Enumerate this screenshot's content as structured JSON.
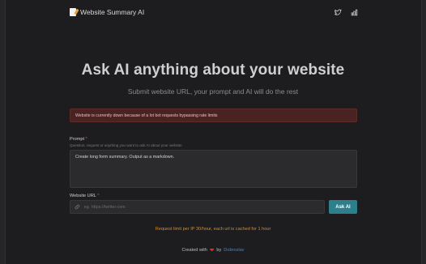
{
  "header": {
    "title": "Website Summary AI",
    "icons": [
      "document-icon",
      "twitter-icon",
      "stats-icon"
    ]
  },
  "hero": {
    "title": "Ask AI anything about your website",
    "subtitle": "Submit website URL, your prompt and AI will do the rest"
  },
  "alert": {
    "text": "Website is currently down because of a lot bot requests bypassing rate limits",
    "color": "#4a2221"
  },
  "prompt": {
    "label": "Prompt",
    "required_mark": "*",
    "hint": "Question, request or anything you want to ask AI about your website",
    "value": "Create long form summary. Output as a markdown."
  },
  "url": {
    "label": "Website URL",
    "required_mark": "*",
    "placeholder": "eg. https://twitter.com",
    "value": ""
  },
  "ask_button": {
    "label": "Ask AI",
    "color": "#2e7f8c"
  },
  "limit_note": {
    "text": "Request limit per IP 30/hour, each url is cached for 1 hour",
    "color": "#d88a2c"
  },
  "footer": {
    "prefix": "Created with",
    "heart": "❤",
    "by": "by",
    "author": "Dobroslav",
    "author_color": "#3d86d6"
  }
}
